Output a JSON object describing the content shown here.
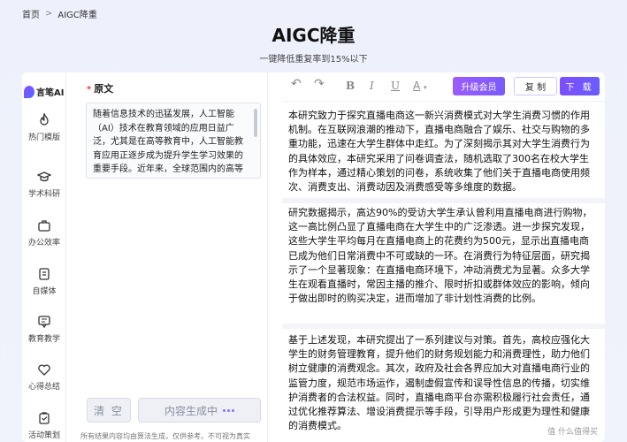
{
  "breadcrumb": {
    "home": "首页",
    "separator": ">",
    "current": "AIGC降重"
  },
  "header": {
    "title": "AIGC降重",
    "subtitle": "一键降低重复率到15%以下"
  },
  "app": {
    "logo_text": "言笔AI"
  },
  "nav": [
    {
      "label": "热门模版",
      "icon": "flame-icon"
    },
    {
      "label": "学术科研",
      "icon": "graduation-cap-icon"
    },
    {
      "label": "办公效率",
      "icon": "briefcase-icon"
    },
    {
      "label": "自媒体",
      "icon": "document-icon"
    },
    {
      "label": "教育教学",
      "icon": "chat-icon"
    },
    {
      "label": "心得总结",
      "icon": "heart-icon"
    },
    {
      "label": "活动策划",
      "icon": "clipboard-icon"
    }
  ],
  "left": {
    "label_required": "*",
    "label": "原文",
    "original_text": "随着信息技术的迅猛发展，人工智能（AI）技术在教育领域的应用日益广泛，尤其是在高等教育中，人工智能教育应用正逐步成为提升学生学习效果的重要手段。近年来，全球范围内的高等",
    "clear_button": "清 空",
    "generate_button": "内容生成中",
    "disclaimer": "所有结果内容均由算法生成，仅供参考。不可视为真实"
  },
  "toolbar": {
    "undo": "↶",
    "redo": "↷",
    "bold": "B",
    "italic": "I",
    "underline": "U",
    "text_color": "A",
    "upgrade_button": "升级会员",
    "copy_button": "复 制",
    "download_button": "下 载"
  },
  "result": {
    "paragraphs": [
      "本研究致力于探究直播电商这一新兴消费模式对大学生消费习惯的作用机制。在互联网浪潮的推动下，直播电商融合了娱乐、社交与购物的多重功能，迅速在大学生群体中走红。为了深刻揭示其对大学生消费行为的具体效应，本研究采用了问卷调查法，随机选取了300名在校大学生作为样本，通过精心策划的问卷，系统收集了他们关于直播电商使用频次、消费支出、消费动因及消费感受等多维度的数据。",
      "研究数据揭示，高达90%的受访大学生承认曾利用直播电商进行购物，这一高比例凸显了直播电商在大学生中的广泛渗透。进一步探究发现，这些大学生平均每月在直播电商上的花费约为500元，显示出直播电商已成为他们日常消费中不可或缺的一环。在消费行为特征层面，研究揭示了一个显著现象：在直播电商环境下，冲动消费尤为显著。众多大学生在观看直播时，常因主播的推介、限时折扣或群体效应的影响，倾向于做出即时的购买决定，进而增加了非计划性消费的比例。",
      "基于上述发现，本研究提出了一系列建议与对策。首先，高校应强化大学生的财务管理教育，提升他们的财务规划能力和消费理性，助力他们树立健康的消费观念。其次，政府及社会各界应加大对直播电商行业的监管力度，规范市场运作，遏制虚假宣传和误导性信息的传播，切实维护消费者的合法权益。同时，直播电商平台亦需积极履行社会责任，通过优化推荐算法、增设消费提示等手段，引导用户形成更为理性和健康的消费模式。"
    ]
  },
  "watermark": "值 什么值得买"
}
